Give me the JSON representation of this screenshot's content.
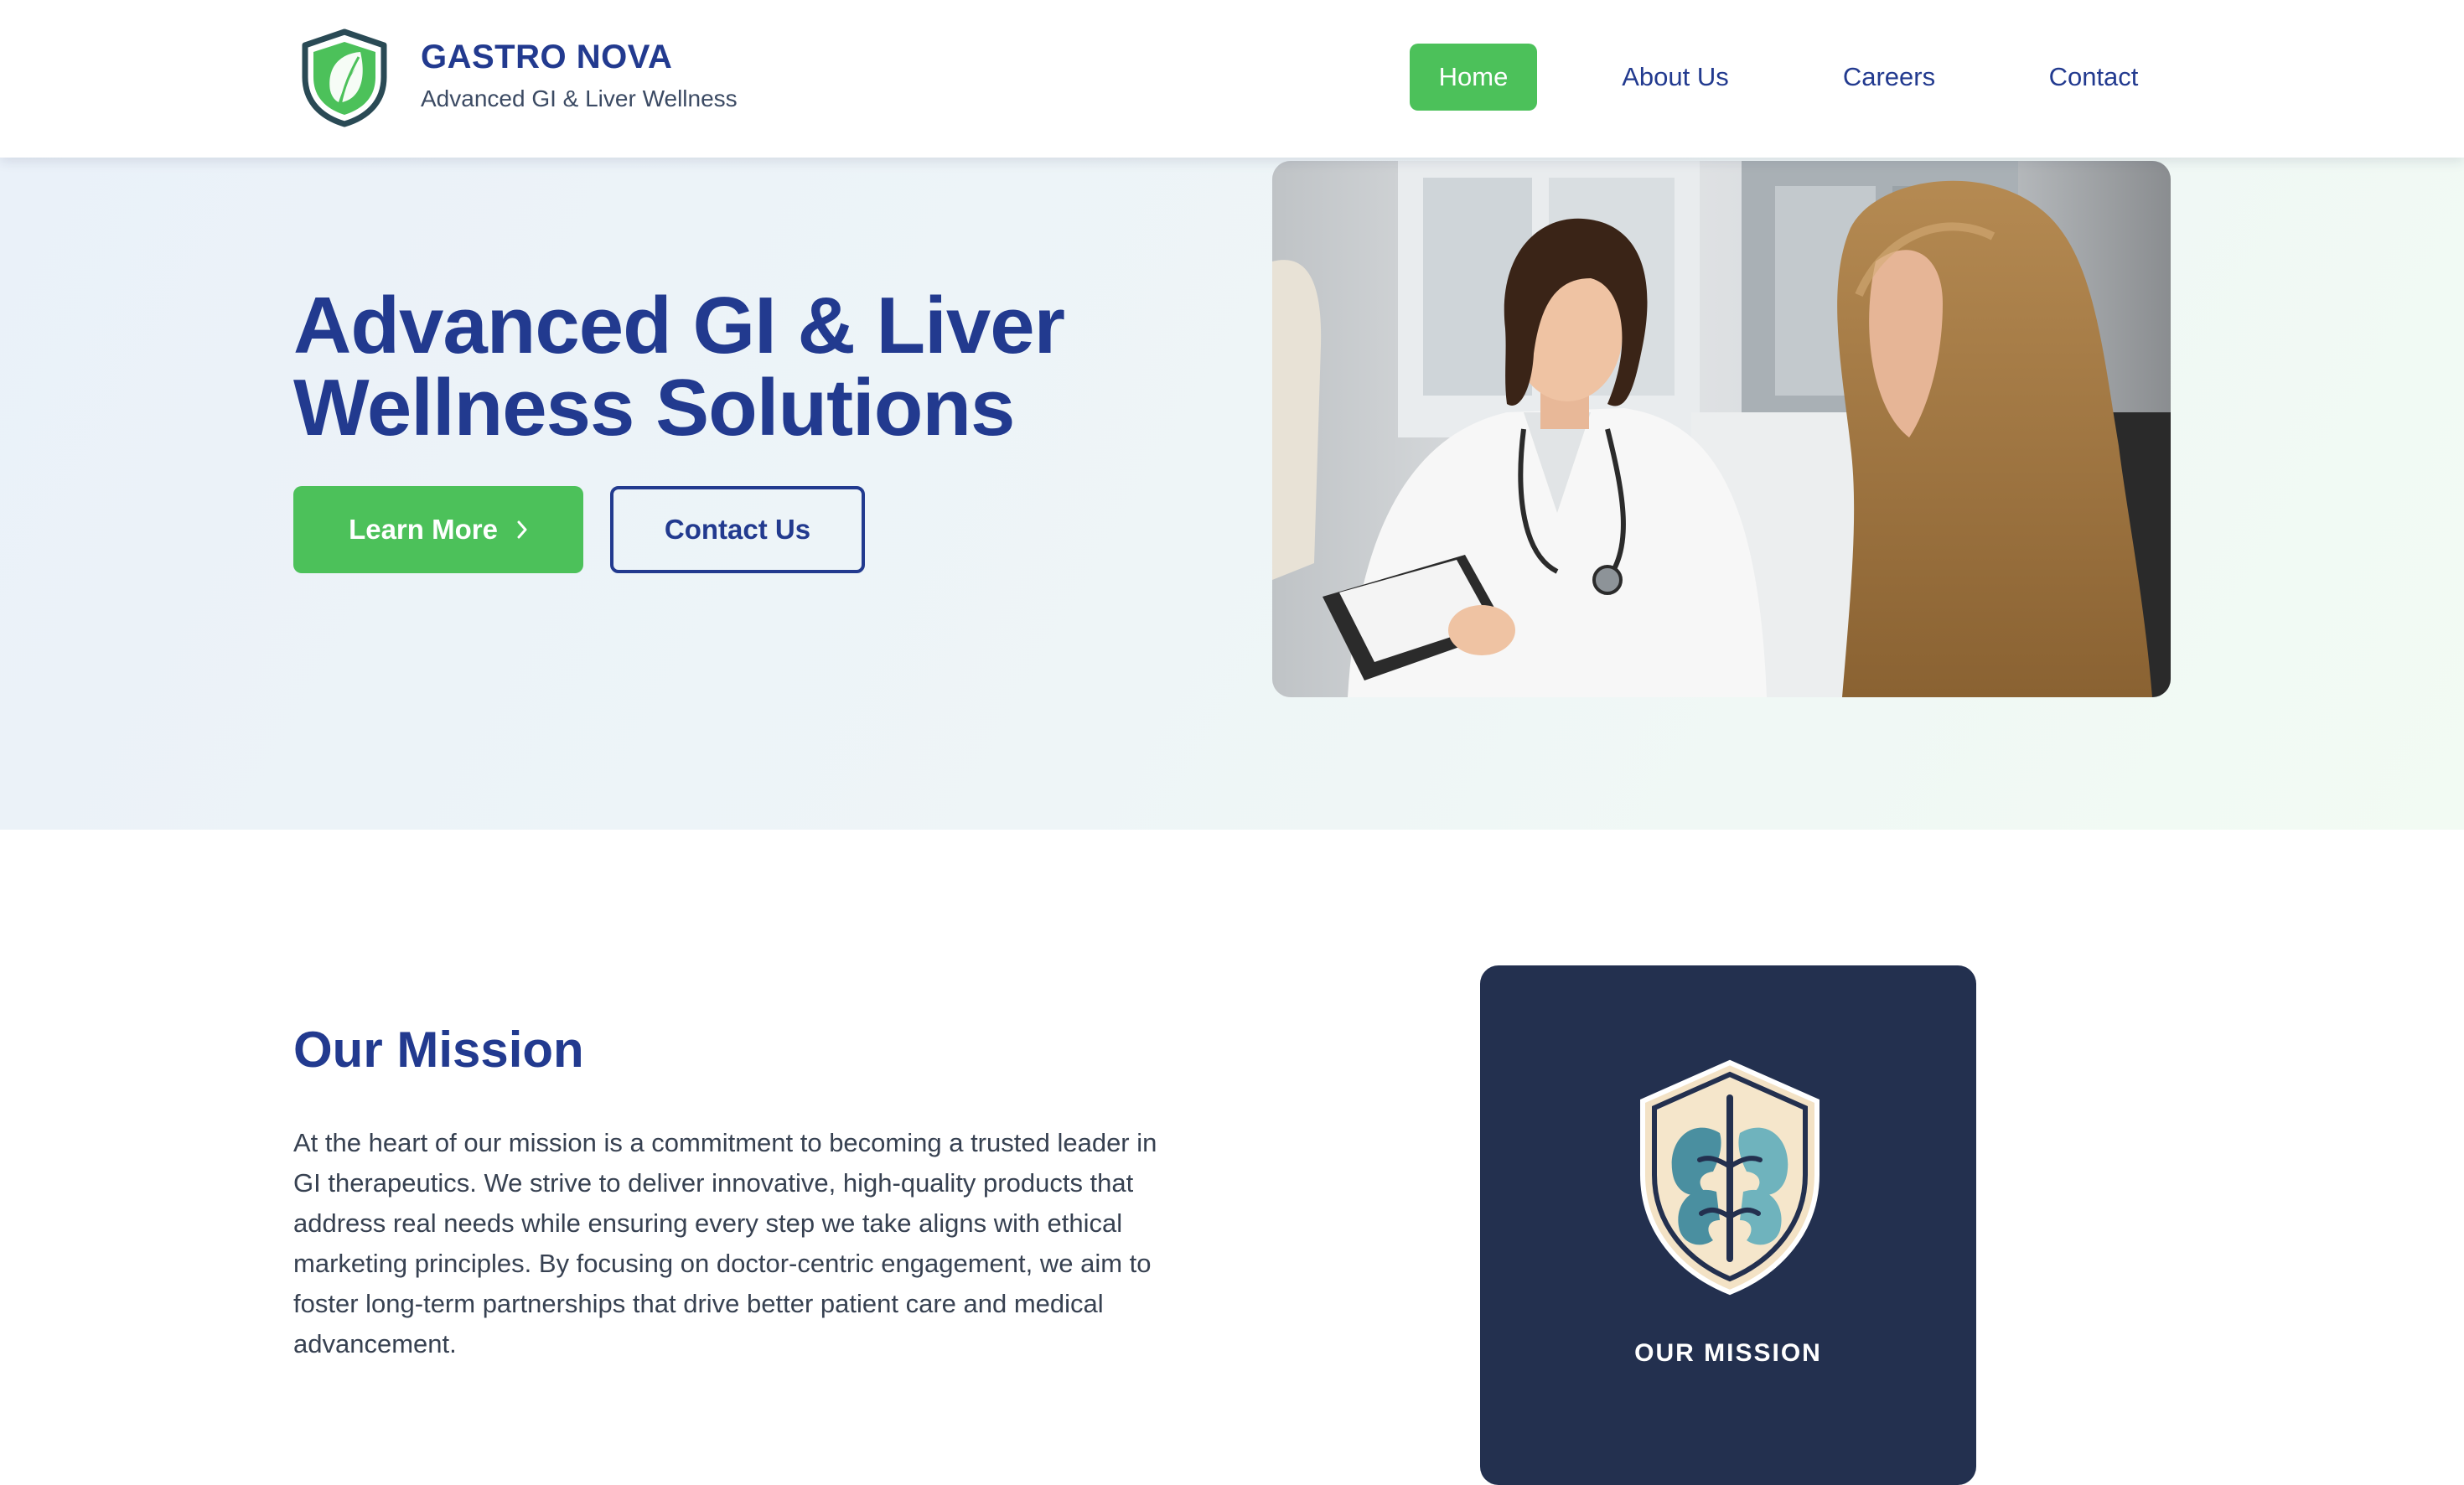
{
  "brand": {
    "name": "GASTRO NOVA",
    "tagline": "Advanced GI & Liver Wellness",
    "logo_icon": "leaf-shield-icon"
  },
  "nav": {
    "items": [
      {
        "label": "Home",
        "active": true
      },
      {
        "label": "About Us",
        "active": false
      },
      {
        "label": "Careers",
        "active": false
      },
      {
        "label": "Contact",
        "active": false
      }
    ]
  },
  "hero": {
    "title": "Advanced GI & Liver Wellness Solutions",
    "primary_button": "Learn More",
    "primary_button_icon": "chevron-right-icon",
    "secondary_button": "Contact Us",
    "image": "doctor-consultation-photo"
  },
  "mission": {
    "title": "Our Mission",
    "body": "At the heart of our mission is a commitment to becoming a trusted leader in GI therapeutics. We strive to deliver innovative, high-quality products that address real needs while ensuring every step we take aligns with ethical marketing principles. By focusing on doctor-centric engagement, we aim to foster long-term partnerships that drive better patient care and medical advancement.",
    "card_label": "OUR MISSION",
    "card_icon": "kidney-shield-icon"
  },
  "colors": {
    "brand_blue": "#223a8f",
    "accent_green": "#4cc15a",
    "card_navy": "#23304f",
    "body_text": "#374151"
  }
}
